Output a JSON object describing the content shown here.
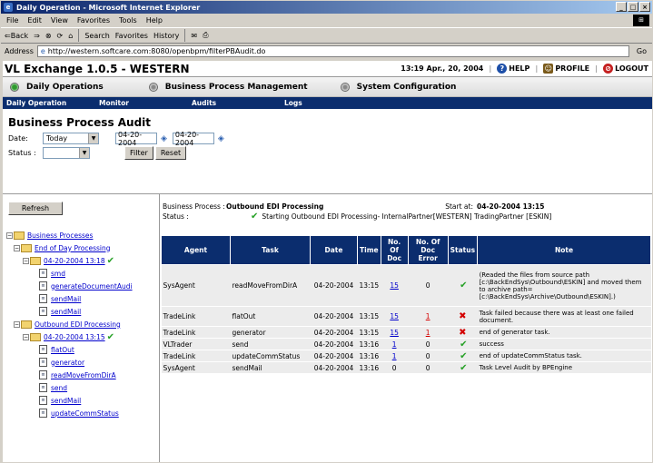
{
  "window": {
    "title": "Daily Operation - Microsoft Internet Explorer",
    "min": "_",
    "max": "□",
    "close": "×"
  },
  "menu": [
    "File",
    "Edit",
    "View",
    "Favorites",
    "Tools",
    "Help"
  ],
  "toolbar": {
    "back": "⇐Back",
    "fwd": "⇒",
    "search": "Search",
    "favorites": "Favorites",
    "history": "History"
  },
  "address": {
    "label": "Address",
    "url": "http://western.softcare.com:8080/openbpm/filterPBAudit.do",
    "go": "Go"
  },
  "app": {
    "title": "VL Exchange 1.0.5 - WESTERN",
    "datetime": "13:19  Apr., 20, 2004",
    "help": "HELP",
    "profile": "PROFILE",
    "logout": "LOGOUT"
  },
  "modules": [
    "Daily Operations",
    "Business Process Management",
    "System Configuration"
  ],
  "subnav": [
    "Daily Operation",
    "Monitor",
    "Audits",
    "Logs"
  ],
  "page": {
    "title": "Business Process Audit"
  },
  "filter": {
    "date_label": "Date:",
    "date_value": "Today",
    "from": "04-20-2004",
    "to": "04-20-2004",
    "status_label": "Status :",
    "status_value": "",
    "filter_btn": "Filter",
    "reset_btn": "Reset"
  },
  "left": {
    "refresh": "Refresh",
    "root": "Business Processes",
    "p1": "End of Day Processing",
    "p1_run": "04-20-2004 13:18",
    "p1_items": [
      "smd",
      "generateDocumentAudi",
      "sendMail",
      "sendMail"
    ],
    "p2": "Outbound EDI Processing",
    "p2_run": "04-20-2004 13:15",
    "p2_items": [
      "flatOut",
      "generator",
      "readMoveFromDirA",
      "send",
      "sendMail",
      "updateCommStatus"
    ]
  },
  "detail": {
    "bp_label": "Business Process :",
    "bp_value": "Outbound EDI Processing",
    "start_label": "Start at:",
    "start_value": "04-20-2004 13:15",
    "status_label": "Status :",
    "status_value": "Starting Outbound EDI Processing- InternalPartner[WESTERN] TradingPartner [ESKIN]"
  },
  "table": {
    "headers": [
      "Agent",
      "Task",
      "Date",
      "Time",
      "No. Of Doc",
      "No. Of Doc Error",
      "Status",
      "Note"
    ],
    "rows": [
      {
        "agent": "SysAgent",
        "task": "readMoveFromDirA",
        "date": "04-20-2004",
        "time": "13:15",
        "docs": "15",
        "errors": "0",
        "status": "ok",
        "note": "(Readed the files from source path [c:\\BackEndSys\\Outbound\\ESKIN] and moved them to archive path=[c:\\BackEndSys\\Archive\\Outbound\\ESKIN].)"
      },
      {
        "agent": "TradeLink",
        "task": "flatOut",
        "date": "04-20-2004",
        "time": "13:15",
        "docs": "15",
        "errors": "1",
        "status": "fail",
        "note": "Task failed because there was at least one failed document."
      },
      {
        "agent": "TradeLink",
        "task": "generator",
        "date": "04-20-2004",
        "time": "13:15",
        "docs": "15",
        "errors": "1",
        "status": "fail",
        "note": "end of generator task."
      },
      {
        "agent": "VLTrader",
        "task": "send",
        "date": "04-20-2004",
        "time": "13:16",
        "docs": "1",
        "errors": "0",
        "status": "ok",
        "note": "success"
      },
      {
        "agent": "TradeLink",
        "task": "updateCommStatus",
        "date": "04-20-2004",
        "time": "13:16",
        "docs": "1",
        "errors": "0",
        "status": "ok",
        "note": "end of updateCommStatus task."
      },
      {
        "agent": "SysAgent",
        "task": "sendMail",
        "date": "04-20-2004",
        "time": "13:16",
        "docs": "0",
        "errors": "0",
        "status": "ok",
        "note": "Task Level Audit by BPEngine"
      }
    ]
  },
  "icons": {
    "ok": "✔",
    "fail": "✖"
  }
}
